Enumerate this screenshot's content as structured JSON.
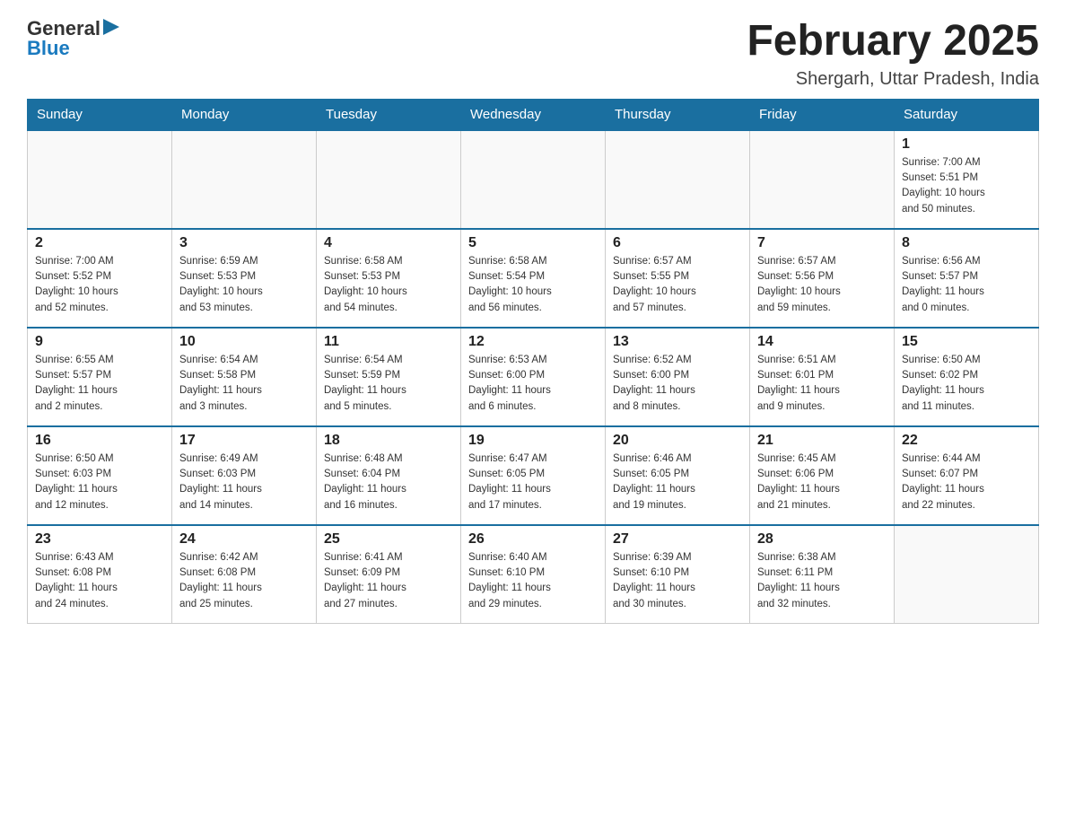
{
  "header": {
    "logo_line1": "General",
    "logo_line2": "Blue",
    "month_title": "February 2025",
    "location": "Shergarh, Uttar Pradesh, India"
  },
  "days_of_week": [
    "Sunday",
    "Monday",
    "Tuesday",
    "Wednesday",
    "Thursday",
    "Friday",
    "Saturday"
  ],
  "weeks": [
    [
      {
        "day": "",
        "info": ""
      },
      {
        "day": "",
        "info": ""
      },
      {
        "day": "",
        "info": ""
      },
      {
        "day": "",
        "info": ""
      },
      {
        "day": "",
        "info": ""
      },
      {
        "day": "",
        "info": ""
      },
      {
        "day": "1",
        "info": "Sunrise: 7:00 AM\nSunset: 5:51 PM\nDaylight: 10 hours\nand 50 minutes."
      }
    ],
    [
      {
        "day": "2",
        "info": "Sunrise: 7:00 AM\nSunset: 5:52 PM\nDaylight: 10 hours\nand 52 minutes."
      },
      {
        "day": "3",
        "info": "Sunrise: 6:59 AM\nSunset: 5:53 PM\nDaylight: 10 hours\nand 53 minutes."
      },
      {
        "day": "4",
        "info": "Sunrise: 6:58 AM\nSunset: 5:53 PM\nDaylight: 10 hours\nand 54 minutes."
      },
      {
        "day": "5",
        "info": "Sunrise: 6:58 AM\nSunset: 5:54 PM\nDaylight: 10 hours\nand 56 minutes."
      },
      {
        "day": "6",
        "info": "Sunrise: 6:57 AM\nSunset: 5:55 PM\nDaylight: 10 hours\nand 57 minutes."
      },
      {
        "day": "7",
        "info": "Sunrise: 6:57 AM\nSunset: 5:56 PM\nDaylight: 10 hours\nand 59 minutes."
      },
      {
        "day": "8",
        "info": "Sunrise: 6:56 AM\nSunset: 5:57 PM\nDaylight: 11 hours\nand 0 minutes."
      }
    ],
    [
      {
        "day": "9",
        "info": "Sunrise: 6:55 AM\nSunset: 5:57 PM\nDaylight: 11 hours\nand 2 minutes."
      },
      {
        "day": "10",
        "info": "Sunrise: 6:54 AM\nSunset: 5:58 PM\nDaylight: 11 hours\nand 3 minutes."
      },
      {
        "day": "11",
        "info": "Sunrise: 6:54 AM\nSunset: 5:59 PM\nDaylight: 11 hours\nand 5 minutes."
      },
      {
        "day": "12",
        "info": "Sunrise: 6:53 AM\nSunset: 6:00 PM\nDaylight: 11 hours\nand 6 minutes."
      },
      {
        "day": "13",
        "info": "Sunrise: 6:52 AM\nSunset: 6:00 PM\nDaylight: 11 hours\nand 8 minutes."
      },
      {
        "day": "14",
        "info": "Sunrise: 6:51 AM\nSunset: 6:01 PM\nDaylight: 11 hours\nand 9 minutes."
      },
      {
        "day": "15",
        "info": "Sunrise: 6:50 AM\nSunset: 6:02 PM\nDaylight: 11 hours\nand 11 minutes."
      }
    ],
    [
      {
        "day": "16",
        "info": "Sunrise: 6:50 AM\nSunset: 6:03 PM\nDaylight: 11 hours\nand 12 minutes."
      },
      {
        "day": "17",
        "info": "Sunrise: 6:49 AM\nSunset: 6:03 PM\nDaylight: 11 hours\nand 14 minutes."
      },
      {
        "day": "18",
        "info": "Sunrise: 6:48 AM\nSunset: 6:04 PM\nDaylight: 11 hours\nand 16 minutes."
      },
      {
        "day": "19",
        "info": "Sunrise: 6:47 AM\nSunset: 6:05 PM\nDaylight: 11 hours\nand 17 minutes."
      },
      {
        "day": "20",
        "info": "Sunrise: 6:46 AM\nSunset: 6:05 PM\nDaylight: 11 hours\nand 19 minutes."
      },
      {
        "day": "21",
        "info": "Sunrise: 6:45 AM\nSunset: 6:06 PM\nDaylight: 11 hours\nand 21 minutes."
      },
      {
        "day": "22",
        "info": "Sunrise: 6:44 AM\nSunset: 6:07 PM\nDaylight: 11 hours\nand 22 minutes."
      }
    ],
    [
      {
        "day": "23",
        "info": "Sunrise: 6:43 AM\nSunset: 6:08 PM\nDaylight: 11 hours\nand 24 minutes."
      },
      {
        "day": "24",
        "info": "Sunrise: 6:42 AM\nSunset: 6:08 PM\nDaylight: 11 hours\nand 25 minutes."
      },
      {
        "day": "25",
        "info": "Sunrise: 6:41 AM\nSunset: 6:09 PM\nDaylight: 11 hours\nand 27 minutes."
      },
      {
        "day": "26",
        "info": "Sunrise: 6:40 AM\nSunset: 6:10 PM\nDaylight: 11 hours\nand 29 minutes."
      },
      {
        "day": "27",
        "info": "Sunrise: 6:39 AM\nSunset: 6:10 PM\nDaylight: 11 hours\nand 30 minutes."
      },
      {
        "day": "28",
        "info": "Sunrise: 6:38 AM\nSunset: 6:11 PM\nDaylight: 11 hours\nand 32 minutes."
      },
      {
        "day": "",
        "info": ""
      }
    ]
  ]
}
